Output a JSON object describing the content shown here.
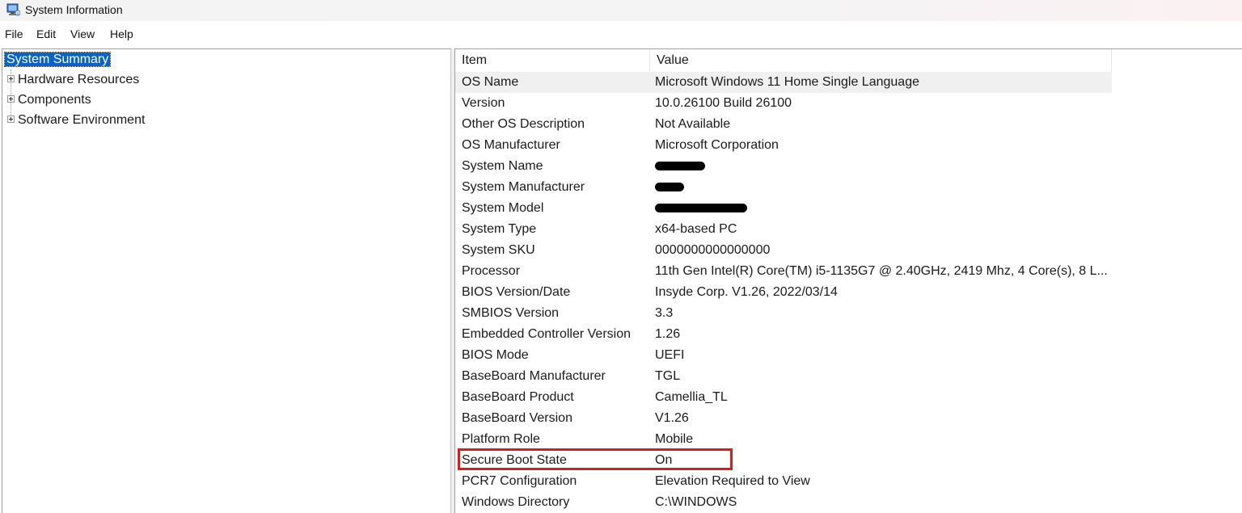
{
  "window": {
    "title": "System Information",
    "app_icon": "system-information-icon"
  },
  "menu": [
    "File",
    "Edit",
    "View",
    "Help"
  ],
  "tree": [
    {
      "label": "System Summary",
      "selected": true,
      "expandable": false
    },
    {
      "label": "Hardware Resources",
      "selected": false,
      "expandable": true
    },
    {
      "label": "Components",
      "selected": false,
      "expandable": true
    },
    {
      "label": "Software Environment",
      "selected": false,
      "expandable": true
    }
  ],
  "table": {
    "columns": [
      "Item",
      "Value"
    ],
    "rows": [
      {
        "item": "OS Name",
        "value": "Microsoft Windows 11 Home Single Language"
      },
      {
        "item": "Version",
        "value": "10.0.26100 Build 26100"
      },
      {
        "item": "Other OS Description",
        "value": "Not Available"
      },
      {
        "item": "OS Manufacturer",
        "value": "Microsoft Corporation"
      },
      {
        "item": "System Name",
        "value": "",
        "redacted": true
      },
      {
        "item": "System Manufacturer",
        "value": "",
        "redacted": true
      },
      {
        "item": "System Model",
        "value": "",
        "redacted": true
      },
      {
        "item": "System Type",
        "value": "x64-based PC"
      },
      {
        "item": "System SKU",
        "value": "0000000000000000"
      },
      {
        "item": "Processor",
        "value": "11th Gen Intel(R) Core(TM) i5-1135G7 @ 2.40GHz, 2419 Mhz, 4 Core(s), 8 L..."
      },
      {
        "item": "BIOS Version/Date",
        "value": "Insyde Corp. V1.26, 2022/03/14"
      },
      {
        "item": "SMBIOS Version",
        "value": "3.3"
      },
      {
        "item": "Embedded Controller Version",
        "value": "1.26"
      },
      {
        "item": "BIOS Mode",
        "value": "UEFI"
      },
      {
        "item": "BaseBoard Manufacturer",
        "value": "TGL"
      },
      {
        "item": "BaseBoard Product",
        "value": "Camellia_TL"
      },
      {
        "item": "BaseBoard Version",
        "value": "V1.26"
      },
      {
        "item": "Platform Role",
        "value": "Mobile"
      },
      {
        "item": "Secure Boot State",
        "value": "On",
        "highlighted": true
      },
      {
        "item": "PCR7 Configuration",
        "value": "Elevation Required to View"
      },
      {
        "item": "Windows Directory",
        "value": "C:\\WINDOWS"
      }
    ]
  },
  "colors": {
    "selection": "#0a64c8",
    "highlight_box": "#e01a1a",
    "selected_row": "#f0f0f0"
  }
}
